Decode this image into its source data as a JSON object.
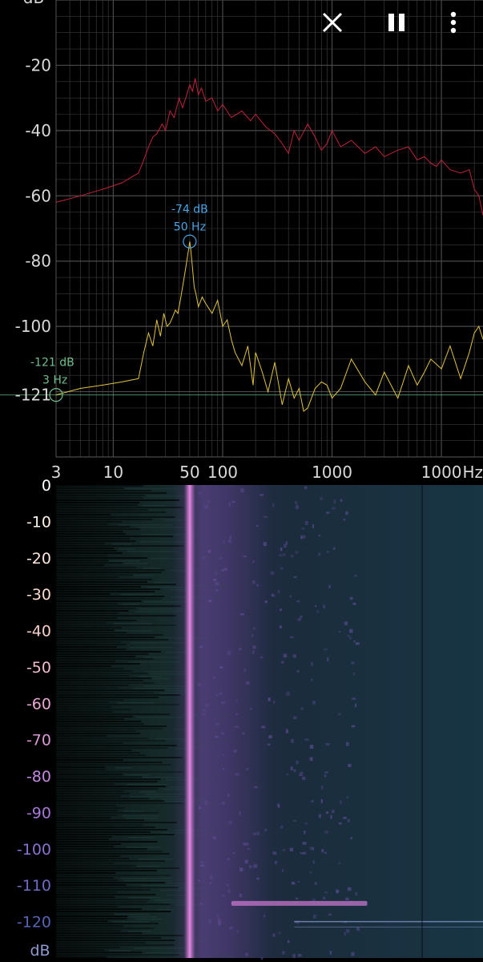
{
  "toolbar": {
    "buttons": [
      {
        "name": "close-icon",
        "label": "close"
      },
      {
        "name": "pause-icon",
        "label": "pause"
      },
      {
        "name": "more-vert-icon",
        "label": "more"
      }
    ]
  },
  "colors": {
    "background": "#000000",
    "grid": "#3a3a3a",
    "peak_hold_series": "#c2223c",
    "live_series": "#e2c341",
    "marker_cyan": "#4aa5e6",
    "marker_green": "#6fbf8c",
    "spectrogram_base": "#0c1e22",
    "spectrogram_band": "#d070d0"
  },
  "chart_data": [
    {
      "type": "line",
      "xscale": "log",
      "xlim": [
        3,
        24000
      ],
      "ylim": [
        -140,
        0
      ],
      "grid": true,
      "xticks": [
        {
          "label": "3",
          "value": 3,
          "color": "#6fbf8c"
        },
        {
          "label": "10",
          "value": 10
        },
        {
          "label": "50",
          "value": 50,
          "color": "#4aa5e6"
        },
        {
          "label": "100",
          "value": 100
        },
        {
          "label": "1000",
          "value": 1000
        },
        {
          "label": "1000",
          "value": 10000
        }
      ],
      "xunit": "Hz",
      "ylabel_top": "dB",
      "yticks": [
        {
          "label": "-20",
          "value": -20
        },
        {
          "label": "-40",
          "value": -40
        },
        {
          "label": "-60",
          "value": -60
        },
        {
          "label": "-80",
          "value": -80
        },
        {
          "label": "-100",
          "value": -100
        },
        {
          "label": "-121",
          "value": -121,
          "color": "#6fbf8c"
        }
      ],
      "series": [
        {
          "color": "#c2223c",
          "x": [
            3,
            5,
            8,
            12,
            17,
            19,
            21,
            23,
            25,
            28,
            30,
            33,
            36,
            40,
            43,
            46,
            50,
            53,
            56,
            60,
            64,
            70,
            80,
            90,
            100,
            120,
            150,
            180,
            200,
            250,
            300,
            350,
            400,
            450,
            500,
            600,
            700,
            800,
            900,
            1000,
            1200,
            1500,
            2000,
            2500,
            3000,
            4000,
            5000,
            6000,
            7000,
            8000,
            9000,
            10000,
            12000,
            15000,
            18000,
            20000,
            22000,
            24000
          ],
          "y": [
            -62,
            -60,
            -58,
            -56,
            -53,
            -49,
            -45,
            -42,
            -41,
            -38,
            -40,
            -34,
            -36,
            -30,
            -33,
            -30,
            -26,
            -28,
            -24,
            -29,
            -27,
            -31,
            -30,
            -34,
            -32,
            -36,
            -34,
            -37,
            -35,
            -39,
            -41,
            -44,
            -47,
            -40,
            -43,
            -38,
            -42,
            -46,
            -44,
            -40,
            -45,
            -43,
            -47,
            -45,
            -48,
            -46,
            -45,
            -49,
            -48,
            -50,
            -51,
            -49,
            -52,
            -53,
            -52,
            -58,
            -60,
            -66
          ]
        },
        {
          "color": "#e2c341",
          "x": [
            3,
            5,
            8,
            12,
            17,
            19,
            21,
            23,
            25,
            27,
            29,
            31,
            33,
            35,
            37,
            39,
            41,
            43,
            45,
            47,
            49,
            50,
            51,
            53,
            55,
            57,
            60,
            65,
            70,
            80,
            90,
            100,
            110,
            120,
            130,
            150,
            170,
            190,
            200,
            230,
            260,
            300,
            350,
            400,
            450,
            500,
            550,
            600,
            700,
            800,
            900,
            1000,
            1200,
            1500,
            2000,
            2500,
            3000,
            4000,
            5000,
            6000,
            7000,
            8000,
            10000,
            12000,
            15000,
            18000,
            20000,
            22000,
            24000
          ],
          "y": [
            -121,
            -119,
            -118,
            -117,
            -116,
            -108,
            -102,
            -106,
            -98,
            -103,
            -96,
            -100,
            -99,
            -97,
            -95,
            -96,
            -92,
            -88,
            -84,
            -80,
            -76,
            -74,
            -76,
            -82,
            -88,
            -90,
            -94,
            -91,
            -93,
            -96,
            -92,
            -100,
            -98,
            -104,
            -108,
            -112,
            -106,
            -118,
            -108,
            -114,
            -120,
            -111,
            -124,
            -116,
            -122,
            -119,
            -126,
            -125,
            -119,
            -117,
            -118,
            -122,
            -119,
            -110,
            -117,
            -121,
            -114,
            -122,
            -112,
            -118,
            -114,
            -110,
            -113,
            -106,
            -116,
            -108,
            -102,
            -100,
            -104
          ]
        }
      ],
      "annotations": [
        {
          "db": "-74 dB",
          "hz": "50 Hz",
          "x": 50,
          "y": -74,
          "color": "#4aa5e6"
        },
        {
          "db": "-121 dB",
          "hz": "3 Hz",
          "x": 3,
          "y": -121,
          "color": "#6fbf8c"
        }
      ],
      "reference_line": {
        "y": -121,
        "color": "#6fbf8c"
      }
    },
    {
      "type": "heatmap",
      "xscale": "log",
      "xlim": [
        3,
        24000
      ],
      "ylim": [
        0,
        130
      ],
      "ylabel_bottom": "dB",
      "yticks": [
        {
          "label": "0",
          "value": 0
        },
        {
          "label": "-10",
          "value": 10
        },
        {
          "label": "-20",
          "value": 20
        },
        {
          "label": "-30",
          "value": 30
        },
        {
          "label": "-40",
          "value": 40
        },
        {
          "label": "-50",
          "value": 50
        },
        {
          "label": "-60",
          "value": 60
        },
        {
          "label": "-70",
          "value": 70
        },
        {
          "label": "-80",
          "value": 80
        },
        {
          "label": "-90",
          "value": 90
        },
        {
          "label": "-100",
          "value": 100
        },
        {
          "label": "-110",
          "value": 110
        },
        {
          "label": "-120",
          "value": 120
        }
      ],
      "tick_colors": [
        "#ffffff",
        "#fff2e8",
        "#ffe6dc",
        "#ffdcd0",
        "#f8cfc8",
        "#f2bccf",
        "#eba9d2",
        "#db99d6",
        "#c488dc",
        "#a779da",
        "#8a71d0",
        "#6e6cc4",
        "#5865b5"
      ],
      "features": [
        {
          "name": "50 Hz band",
          "x": 50,
          "color": "#d070d0"
        },
        {
          "name": "transient",
          "x_from": 120,
          "x_to": 2100,
          "y": 115,
          "color": "#e080e0"
        }
      ]
    }
  ]
}
